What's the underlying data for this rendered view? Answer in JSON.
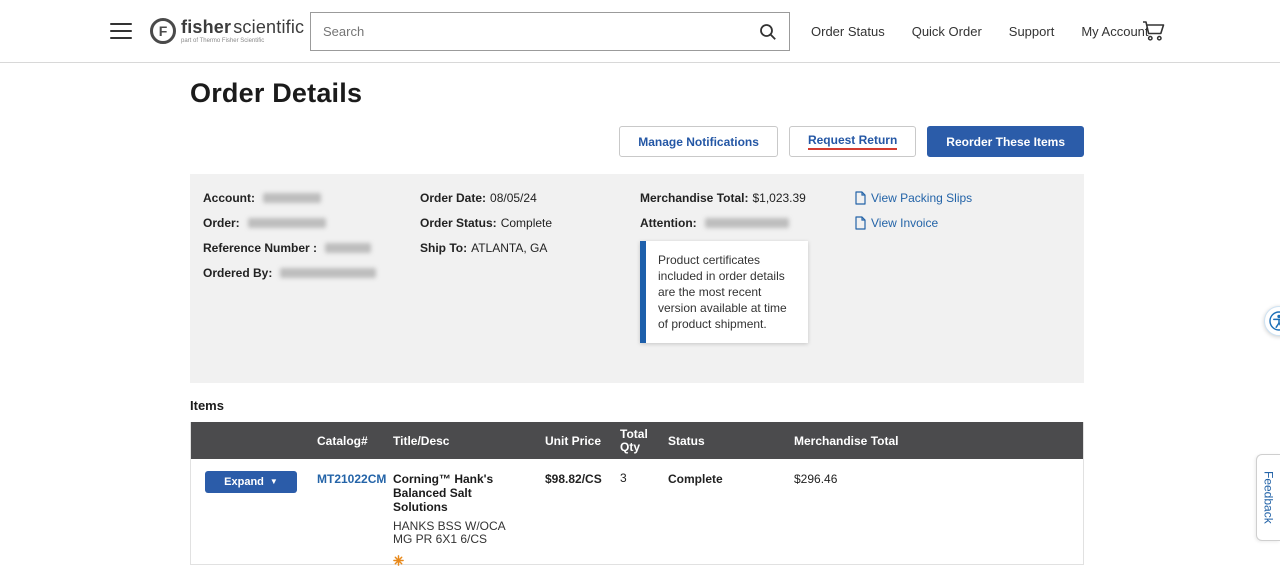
{
  "header": {
    "logo": {
      "initial": "F",
      "brand_bold": "fisher",
      "brand_regular": "scientific",
      "tagline": "part of Thermo Fisher Scientific"
    },
    "search": {
      "placeholder": "Search"
    },
    "nav": [
      {
        "label": "Order Status"
      },
      {
        "label": "Quick Order"
      },
      {
        "label": "Support"
      },
      {
        "label": "My Account"
      }
    ]
  },
  "page": {
    "title": "Order Details",
    "actions": {
      "manage_notifications": "Manage Notifications",
      "request_return": "Request Return",
      "reorder": "Reorder These Items"
    }
  },
  "summary": {
    "labels": {
      "account": "Account:",
      "order": "Order:",
      "reference": "Reference Number :",
      "ordered_by": "Ordered By:",
      "order_date": "Order Date:",
      "order_status": "Order Status:",
      "ship_to": "Ship To:",
      "merchandise_total": "Merchandise Total:",
      "attention": "Attention:"
    },
    "values": {
      "order_date": "08/05/24",
      "order_status": "Complete",
      "ship_to": "ATLANTA, GA",
      "merchandise_total": "$1,023.39"
    },
    "links": {
      "packing_slips": "View Packing Slips",
      "invoice": "View Invoice"
    },
    "certificate_note": "Product certificates included in order details are the most recent version available at time of product shipment."
  },
  "items": {
    "section_label": "Items",
    "columns": {
      "catalog": "Catalog#",
      "title": "Title/Desc",
      "unit_price": "Unit Price",
      "qty": "Total Qty",
      "status": "Status",
      "merch_total": "Merchandise Total"
    },
    "row": {
      "expand_label": "Expand",
      "catalog": "MT21022CM",
      "title": "Corning™ Hank's Balanced Salt Solutions",
      "desc": "HANKS BSS W/OCA MG PR 6X1 6/CS",
      "unit_price": "$98.82/CS",
      "qty": "3",
      "status": "Complete",
      "merch_total": "$296.46"
    }
  },
  "floating": {
    "feedback": "Feedback"
  },
  "icons": {
    "caret_down": "▼"
  },
  "colors": {
    "brand_blue": "#2b5ca9",
    "link_blue": "#2464a8",
    "table_header_gray": "#4b4b4d",
    "summary_bg": "#f1f1f1",
    "accent_red": "#d43b2f",
    "badge_orange": "#e8891b"
  }
}
